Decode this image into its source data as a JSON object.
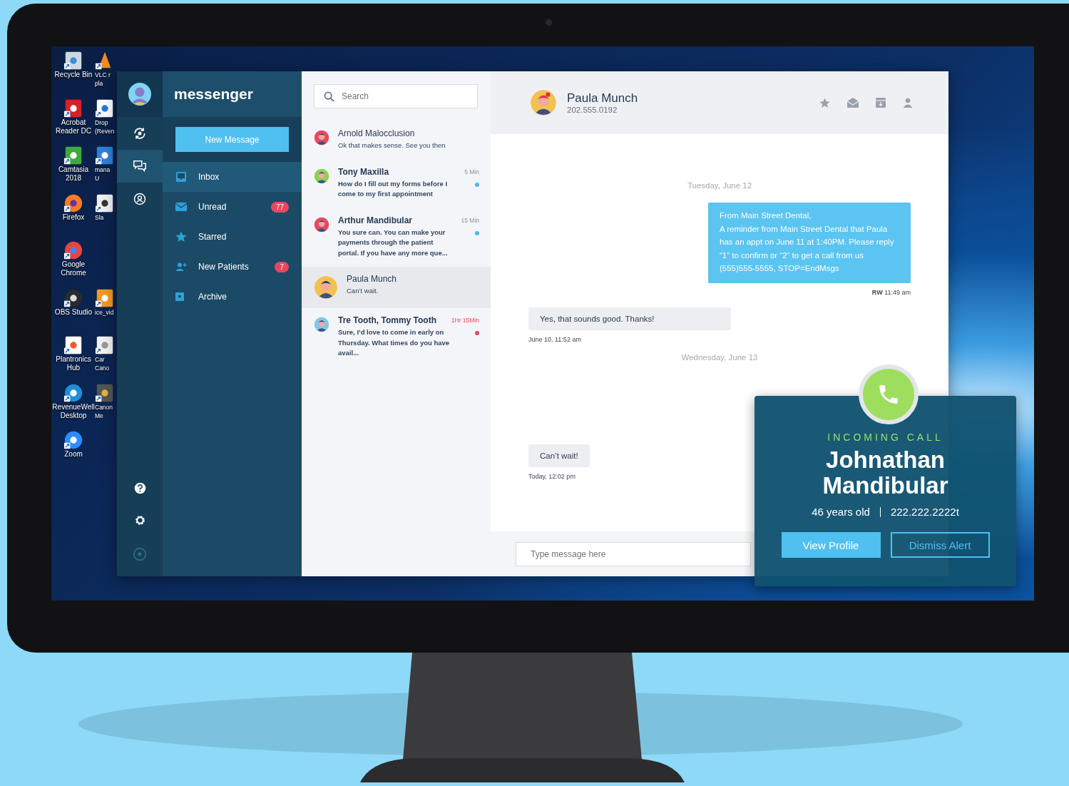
{
  "desktop": {
    "icons_column_1": [
      {
        "label": "Recycle Bin"
      },
      {
        "label": "Acrobat\nReader DC"
      },
      {
        "label": "Camtasia\n2018"
      },
      {
        "label": "Firefox"
      },
      {
        "label": "Google\nChrome"
      },
      {
        "label": "OBS Studio"
      },
      {
        "label": "Plantronics\nHub"
      },
      {
        "label": "RevenueWell\nDesktop"
      },
      {
        "label": "Zoom"
      }
    ],
    "icons_column_2": [
      {
        "label": "VLC r\npla"
      },
      {
        "label": "Drop\n(Reven"
      },
      {
        "label": "mana\nU"
      },
      {
        "label": "Sla"
      },
      {
        "label": "ice_vid"
      },
      {
        "label": "Car\nCano"
      },
      {
        "label": "Canon\nMe"
      }
    ]
  },
  "app": {
    "rail": {
      "items": [
        {
          "selected": false
        },
        {
          "selected": true
        },
        {
          "selected": false
        }
      ]
    },
    "nav": {
      "brand": "messenger",
      "new_message": "New Message",
      "items": [
        {
          "label": "Inbox",
          "selected": true
        },
        {
          "label": "Unread",
          "count": "77",
          "selected": false
        },
        {
          "label": "Starred",
          "selected": false
        },
        {
          "label": "New Patients",
          "count": "7",
          "selected": false
        },
        {
          "label": "Archive",
          "selected": false
        }
      ]
    },
    "conversations": {
      "search": {
        "placeholder": "Search"
      },
      "items": [
        {
          "name": "Arnold Malocclusion",
          "preview": "Ok that makes sense. See you then",
          "unread": false,
          "selected": false,
          "avatar": {
            "color": "#e8475f"
          }
        },
        {
          "name": "Tony Maxilla",
          "preview": "How do I fill out my forms before I come to my first appointment",
          "time": "5 Min",
          "urgent": false,
          "unread": true,
          "selected": false,
          "avatar": {
            "color": "#8fd14f"
          },
          "dot": {
            "color": "#4fb8e6"
          }
        },
        {
          "name": "Arthur Mandibular",
          "preview": "You sure can. You can make your payments through the patient portal. If you have any more que...",
          "time": "15 Min",
          "urgent": false,
          "unread": true,
          "selected": false,
          "avatar": {
            "color": "#e8475f"
          },
          "dot": {
            "color": "#4fb8e6"
          }
        },
        {
          "name": "Paula Munch",
          "preview": "Can’t wait.",
          "unread": false,
          "selected": true,
          "avatar": {
            "color": "#f2c14e"
          }
        },
        {
          "name": "Tre Tooth, Tommy Tooth",
          "preview": "Sure, I’d love to come in early on Thursday. What times do you have avail...",
          "time": "1Hr 15Min",
          "urgent": true,
          "unread": true,
          "selected": false,
          "avatar": {
            "color": "#7ec8e3"
          },
          "dot": {
            "color": "#e8475f"
          }
        }
      ]
    },
    "chat": {
      "contact": {
        "name": "Paula Munch",
        "phone": "202.555.0192"
      },
      "messages": [
        {
          "kind": "date",
          "text": "Tuesday, June 12"
        },
        {
          "kind": "outgoing",
          "text": "From Main Street Dental,\nA reminder from Main Street Dental that Paula has an appt on June 11 at 1:40PM. Please reply “1” to confirm or  “2” to get a call from us (555)555-5555, STOP=EndMsgs",
          "meta": "**RW** 11:49 am"
        },
        {
          "kind": "incoming",
          "text": "Yes, that sounds good. Thanks!",
          "meta": "June 10, 11:52 am"
        },
        {
          "kind": "date",
          "text": "Wednesday, June 13"
        },
        {
          "kind": "incoming",
          "text": "Can’t wait!",
          "meta": "Today, 12:02 pm"
        }
      ],
      "composer": {
        "placeholder": "Type message here"
      }
    }
  },
  "incoming_call": {
    "label": "INCOMING CALL",
    "name": "Johnathan Mandibular",
    "age": "46 years old",
    "phone": "222.222.2222t",
    "buttons": [
      {
        "label": "View Profile",
        "kind": "primary"
      },
      {
        "label": "Dismiss Alert",
        "kind": "outline"
      }
    ]
  }
}
